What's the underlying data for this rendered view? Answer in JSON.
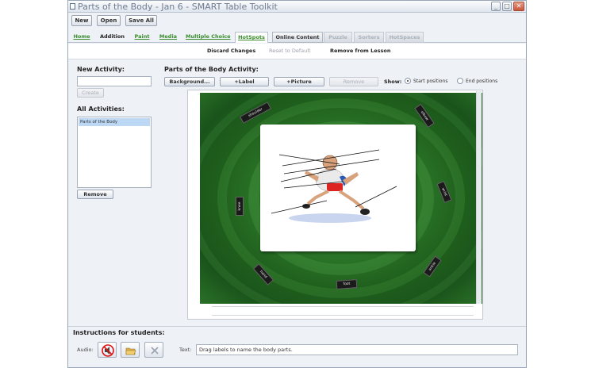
{
  "window": {
    "title": "Parts of the Body - Jan 6 - SMART Table Toolkit",
    "minimize": "_",
    "maximize": "□",
    "close": "✕"
  },
  "toolbar": {
    "new_label": "New",
    "open_label": "Open",
    "save_all_label": "Save All"
  },
  "tabs": [
    {
      "label": "Home"
    },
    {
      "label": "Addition"
    },
    {
      "label": "Paint"
    },
    {
      "label": "Media"
    },
    {
      "label": "Multiple Choice"
    },
    {
      "label": "HotSpots"
    },
    {
      "label": "Online Content"
    },
    {
      "label": "Puzzle"
    },
    {
      "label": "Sorters"
    },
    {
      "label": "HotSpaces"
    }
  ],
  "actions": {
    "discard": "Discard Changes",
    "reset": "Reset to Default",
    "remove_lesson": "Remove from Lesson"
  },
  "sidebar": {
    "new_activity_label": "New Activity:",
    "new_activity_value": "",
    "create_label": "Create",
    "all_activities_label": "All Activities:",
    "activities": [
      "Parts of the Body"
    ],
    "remove_label": "Remove"
  },
  "editor": {
    "heading": "Parts of the Body Activity:",
    "background_label": "Background...",
    "add_label_label": "+Label",
    "add_picture_label": "+Picture",
    "remove_label": "Remove",
    "show_label": "Show:",
    "start_positions": "Start positions",
    "end_positions": "End positions"
  },
  "canvas_labels": [
    "shoulder",
    "elbow",
    "knee",
    "wrist",
    "hand",
    "foot",
    "ankle",
    "hip"
  ],
  "instructions": {
    "title": "Instructions for students:",
    "audio_label": "Audio:",
    "text_label": "Text:",
    "text_value": "Drag labels to name the body parts."
  },
  "icons": {
    "audio": "no-audio-icon",
    "folder": "open-folder-icon",
    "clear": "clear-icon"
  },
  "colors": {
    "canvas_green": "#2d7a2a",
    "tab_green": "#3a8d2c",
    "selection_blue": "#bcd8f4"
  }
}
